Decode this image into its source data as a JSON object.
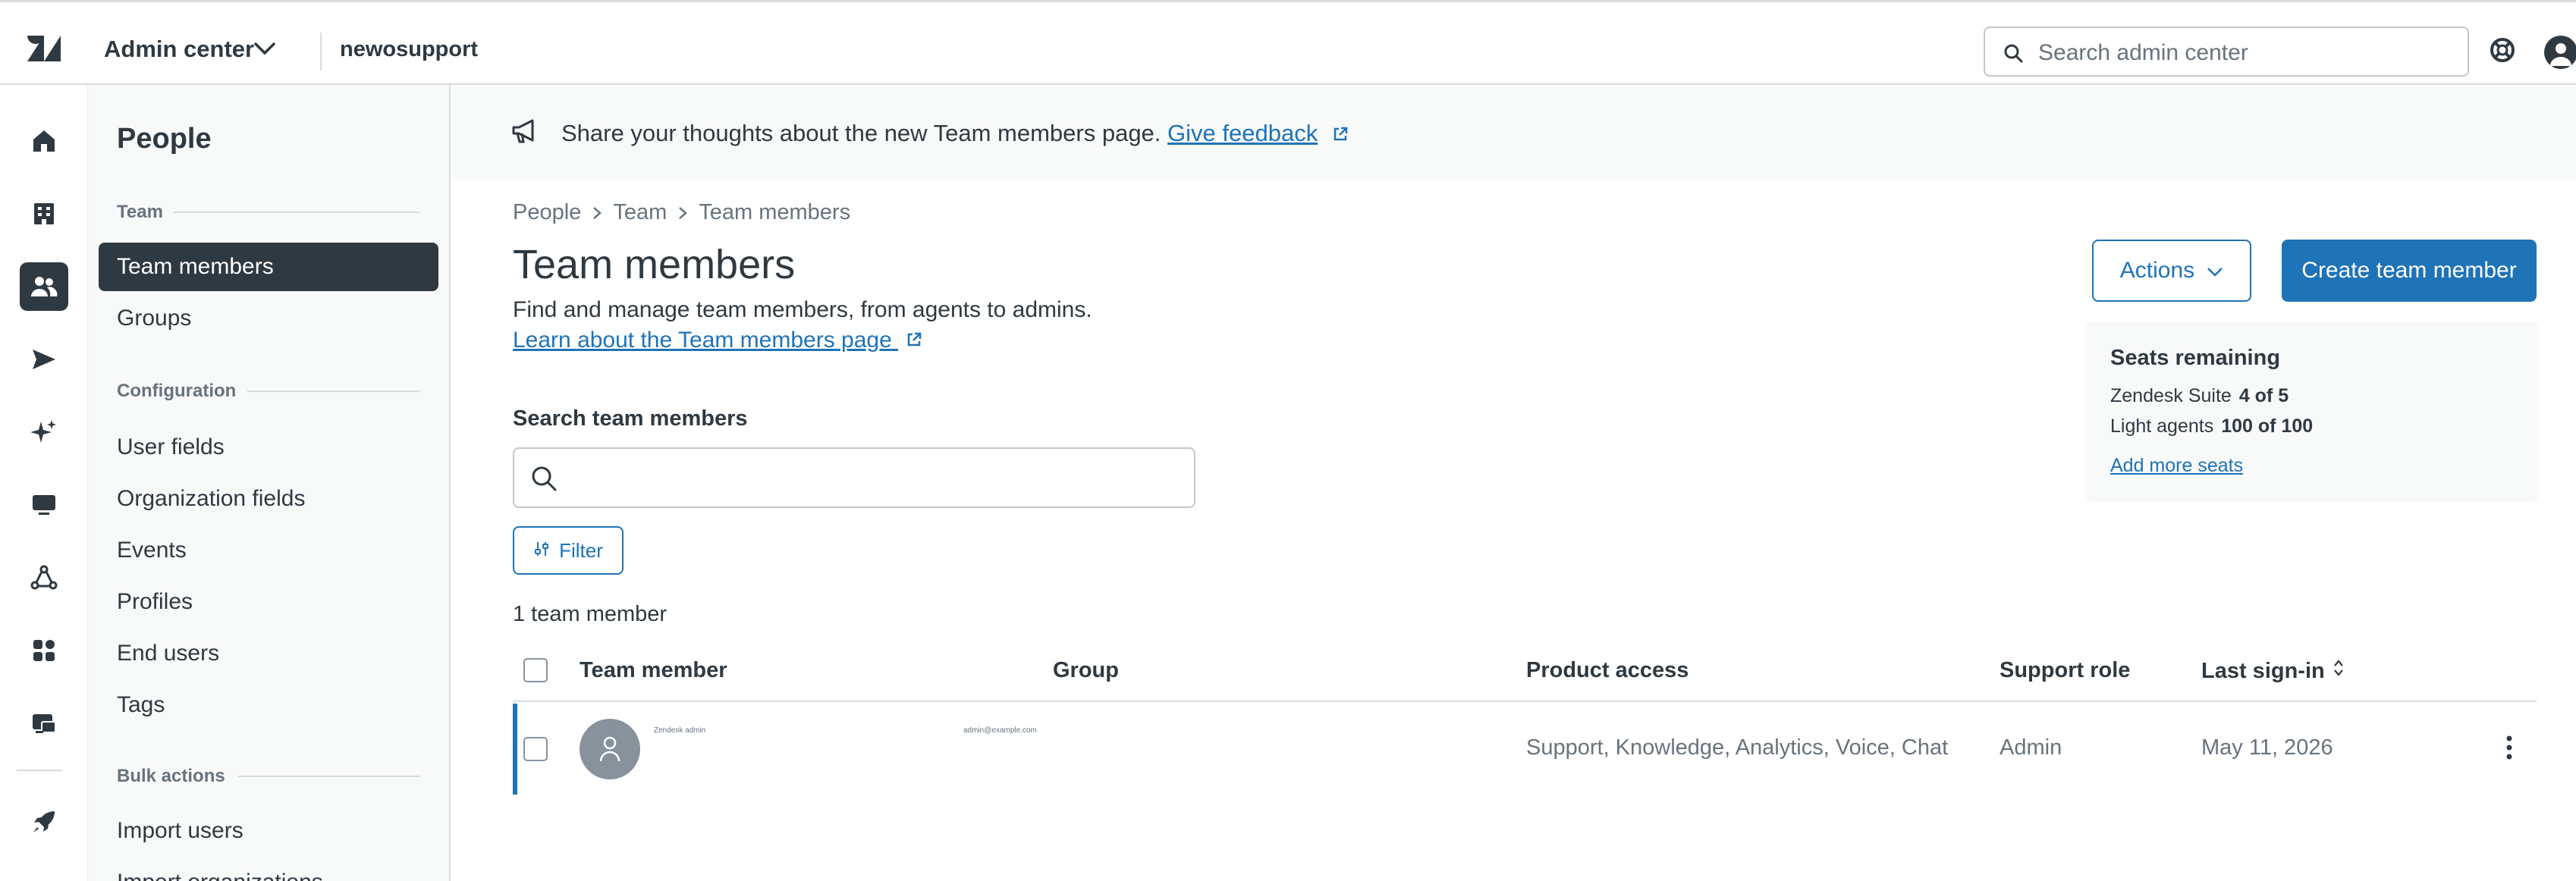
{
  "topbar": {
    "app_title": "Admin center",
    "account_name": "newosupport",
    "search_placeholder": "Search admin center"
  },
  "rail": {
    "items": [
      "home",
      "buildings",
      "people",
      "channels",
      "ai",
      "workspaces",
      "objects",
      "apps",
      "account",
      "getting-started"
    ],
    "active": "people"
  },
  "sidebar": {
    "title": "People",
    "sections": [
      {
        "label": "Team",
        "items": [
          "Team members",
          "Groups"
        ]
      },
      {
        "label": "Configuration",
        "items": [
          "User fields",
          "Organization fields",
          "Events",
          "Profiles",
          "End users",
          "Tags"
        ]
      },
      {
        "label": "Bulk actions",
        "items": [
          "Import users",
          "Import organizations"
        ]
      }
    ],
    "active_item": "Team members"
  },
  "banner": {
    "text": "Share your thoughts about the new Team members page.",
    "link": "Give feedback"
  },
  "breadcrumb": [
    "People",
    "Team",
    "Team members"
  ],
  "page": {
    "title": "Team members",
    "description": "Find and manage team members, from agents to admins.",
    "learn_link": "Learn about the Team members page",
    "actions_label": "Actions",
    "create_label": "Create team member"
  },
  "seats": {
    "title": "Seats remaining",
    "rows": [
      {
        "label": "Zendesk Suite",
        "value": "4 of 5"
      },
      {
        "label": "Light agents",
        "value": "100 of 100"
      }
    ],
    "add_link": "Add more seats"
  },
  "search": {
    "label": "Search team members",
    "placeholder": ""
  },
  "filter_label": "Filter",
  "count_text": "1 team member",
  "table": {
    "columns": [
      "Team member",
      "Group",
      "Product access",
      "Support role",
      "Last sign-in"
    ],
    "rows": [
      {
        "name": "Zendesk admin",
        "email": "admin@example.com",
        "group": "",
        "product_access": "Support, Knowledge, Analytics, Voice, Chat",
        "support_role": "Admin",
        "last_sign_in": "May 11, 2026"
      }
    ]
  },
  "colors": {
    "accent": "#1f73b7",
    "dark": "#2f3941",
    "muted": "#68737d",
    "border": "#d8dcde",
    "panel": "#f8f9f9"
  }
}
